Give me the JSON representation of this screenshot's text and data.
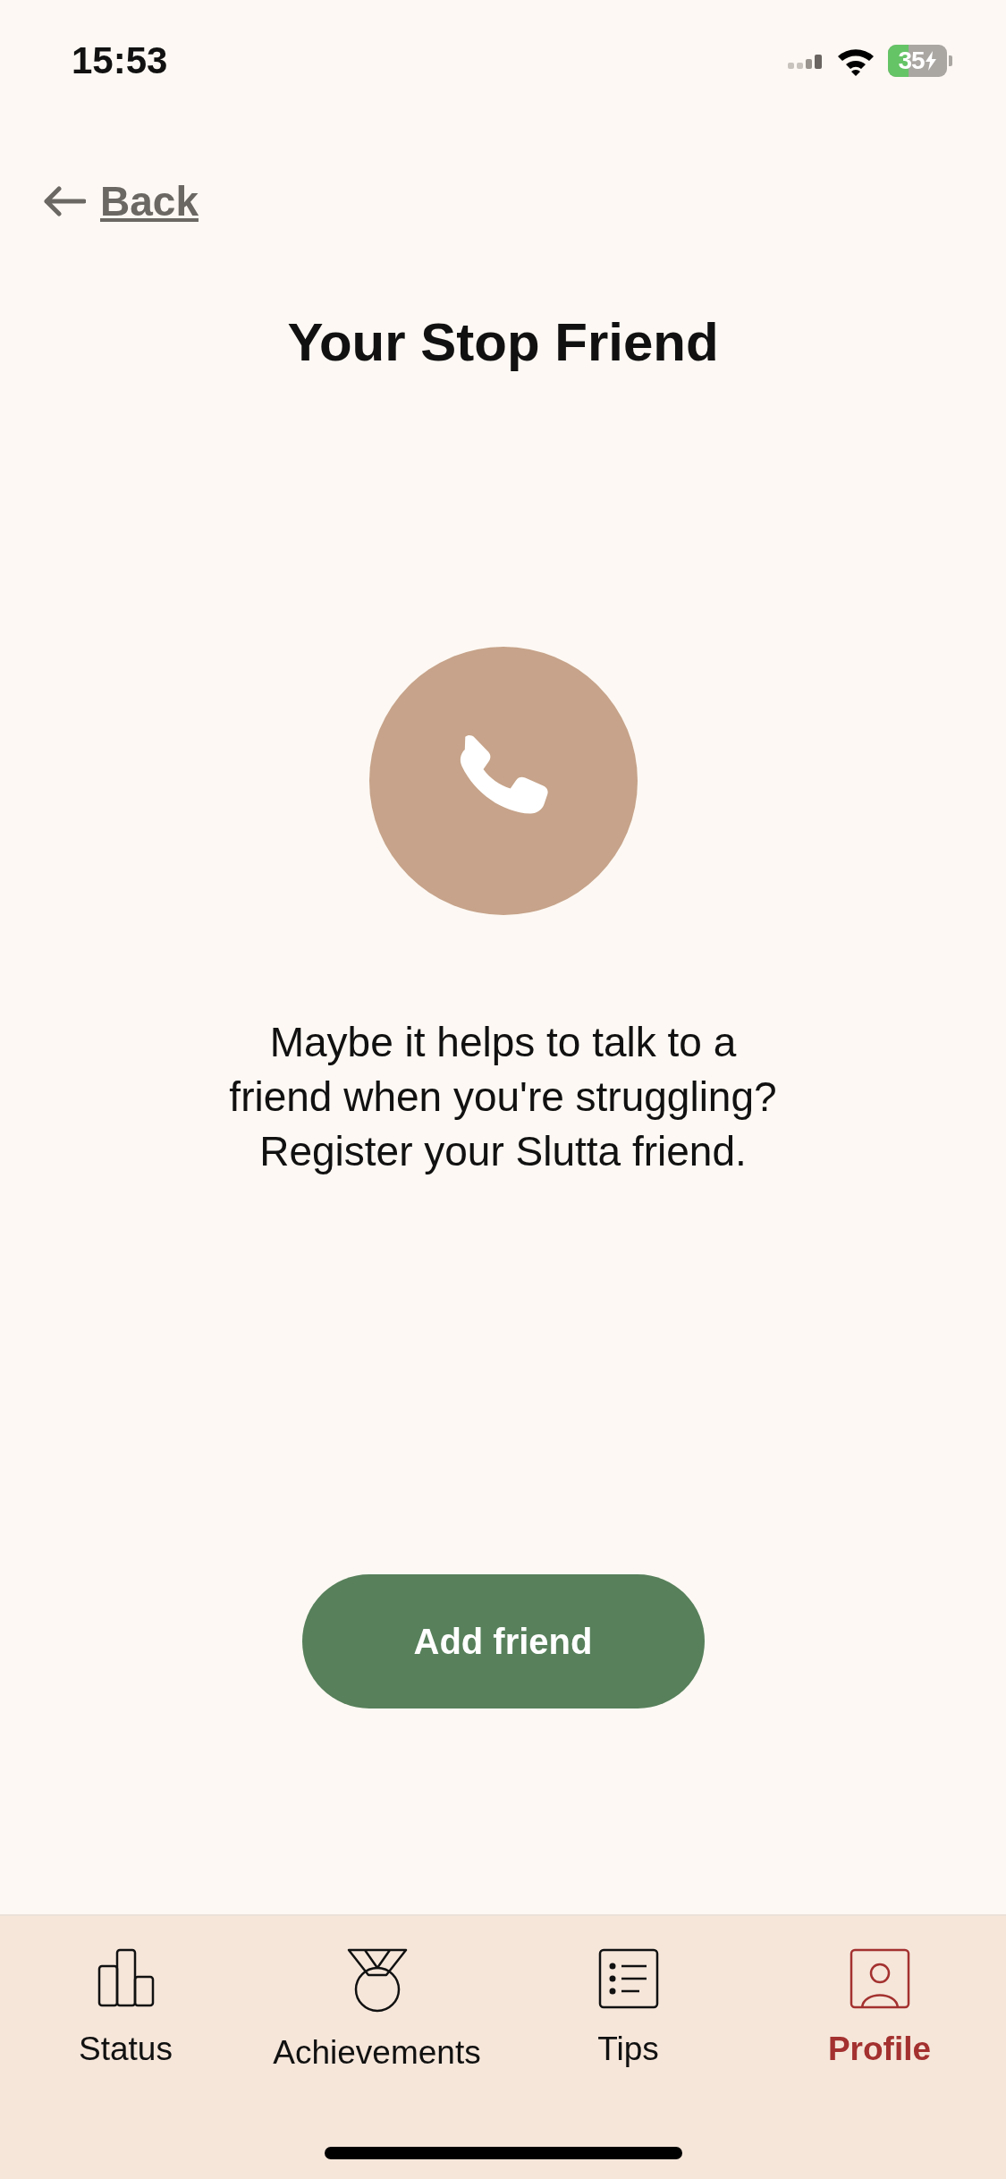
{
  "status_bar": {
    "time": "15:53",
    "battery": "35"
  },
  "back": {
    "label": "Back"
  },
  "title": "Your Stop Friend",
  "message": "Maybe it helps to talk to a friend when you're struggling? Register your Slutta friend.",
  "button": {
    "label": "Add friend"
  },
  "tabs": [
    {
      "label": "Status",
      "kind": "chart",
      "selected": false
    },
    {
      "label": "Achievements",
      "kind": "medal",
      "selected": false
    },
    {
      "label": "Tips",
      "kind": "list",
      "selected": false
    },
    {
      "label": "Profile",
      "kind": "person",
      "selected": true
    }
  ]
}
